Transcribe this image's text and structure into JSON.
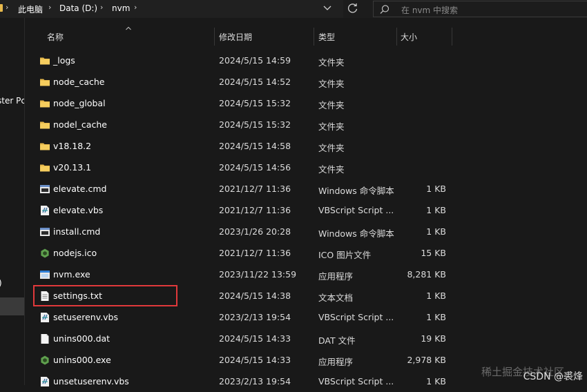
{
  "address_bar": {
    "crumbs": [
      "此电脑",
      "Data (D:)",
      "nvm"
    ]
  },
  "search": {
    "placeholder": "在 nvm 中搜索"
  },
  "nav_pane": {
    "items": [
      "ster Pc",
      ")"
    ]
  },
  "columns": {
    "name": "名称",
    "date": "修改日期",
    "type": "类型",
    "size": "大小"
  },
  "files": [
    {
      "name": "_logs",
      "date": "2024/5/15 14:59",
      "type": "文件夹",
      "size": "",
      "icon": "folder-icon"
    },
    {
      "name": "node_cache",
      "date": "2024/5/15 14:52",
      "type": "文件夹",
      "size": "",
      "icon": "folder-icon"
    },
    {
      "name": "node_global",
      "date": "2024/5/15 15:32",
      "type": "文件夹",
      "size": "",
      "icon": "folder-icon"
    },
    {
      "name": "nodel_cache",
      "date": "2024/5/15 15:32",
      "type": "文件夹",
      "size": "",
      "icon": "folder-icon"
    },
    {
      "name": "v18.18.2",
      "date": "2024/5/15 14:58",
      "type": "文件夹",
      "size": "",
      "icon": "folder-icon"
    },
    {
      "name": "v20.13.1",
      "date": "2024/5/15 14:56",
      "type": "文件夹",
      "size": "",
      "icon": "folder-icon"
    },
    {
      "name": "elevate.cmd",
      "date": "2021/12/7 11:36",
      "type": "Windows 命令脚本",
      "size": "1 KB",
      "icon": "cmd-file-icon"
    },
    {
      "name": "elevate.vbs",
      "date": "2021/12/7 11:36",
      "type": "VBScript Script ...",
      "size": "1 KB",
      "icon": "vbs-file-icon"
    },
    {
      "name": "install.cmd",
      "date": "2023/1/26 20:28",
      "type": "Windows 命令脚本",
      "size": "1 KB",
      "icon": "cmd-file-icon"
    },
    {
      "name": "nodejs.ico",
      "date": "2021/12/7 11:36",
      "type": "ICO 图片文件",
      "size": "15 KB",
      "icon": "nodejs-icon"
    },
    {
      "name": "nvm.exe",
      "date": "2023/11/22 13:59",
      "type": "应用程序",
      "size": "8,281 KB",
      "icon": "exe-file-icon"
    },
    {
      "name": "settings.txt",
      "date": "2024/5/15 14:38",
      "type": "文本文档",
      "size": "1 KB",
      "icon": "txt-file-icon"
    },
    {
      "name": "setuserenv.vbs",
      "date": "2023/2/13 19:54",
      "type": "VBScript Script ...",
      "size": "1 KB",
      "icon": "vbs-file-icon"
    },
    {
      "name": "unins000.dat",
      "date": "2024/5/15 14:33",
      "type": "DAT 文件",
      "size": "19 KB",
      "icon": "dat-file-icon"
    },
    {
      "name": "unins000.exe",
      "date": "2024/5/15 14:33",
      "type": "应用程序",
      "size": "2,978 KB",
      "icon": "nodejs-icon"
    },
    {
      "name": "unsetuserenv.vbs",
      "date": "2023/2/13 19:54",
      "type": "VBScript Script ...",
      "size": "1 KB",
      "icon": "vbs-file-icon"
    }
  ],
  "watermark": {
    "text": "CSDN @裘烽",
    "sub": "稀土掘金技术社区"
  },
  "colors": {
    "folder": "#e7b94c",
    "highlight": "#e1393b",
    "background": "#191919",
    "nodejs": "#5fa04e"
  }
}
